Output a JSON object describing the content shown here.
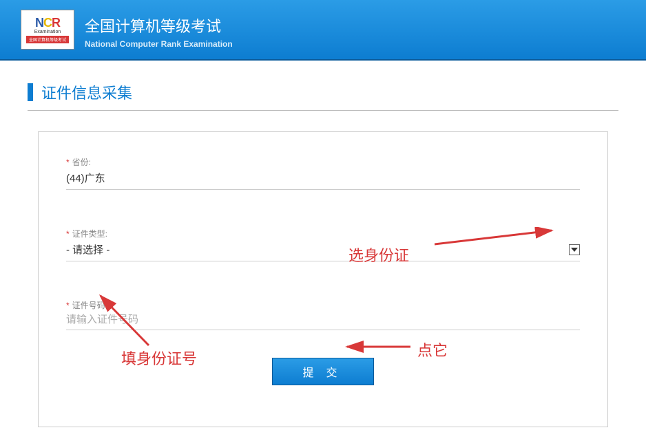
{
  "header": {
    "logo_main_n": "N",
    "logo_main_c": "C",
    "logo_main_r": "R",
    "logo_sub": "Examination",
    "logo_bar": "全国计算机等级考试",
    "title_cn": "全国计算机等级考试",
    "title_en": "National Computer Rank Examination"
  },
  "section": {
    "title": "证件信息采集"
  },
  "form": {
    "province": {
      "label": "省份:",
      "value": "(44)广东"
    },
    "cert_type": {
      "label": "证件类型:",
      "value": "- 请选择 -"
    },
    "cert_number": {
      "label": "证件号码:",
      "placeholder": "请输入证件号码"
    },
    "submit_label": "提交"
  },
  "annotations": {
    "select_id": "选身份证",
    "fill_id": "填身份证号",
    "click_it": "点它"
  }
}
